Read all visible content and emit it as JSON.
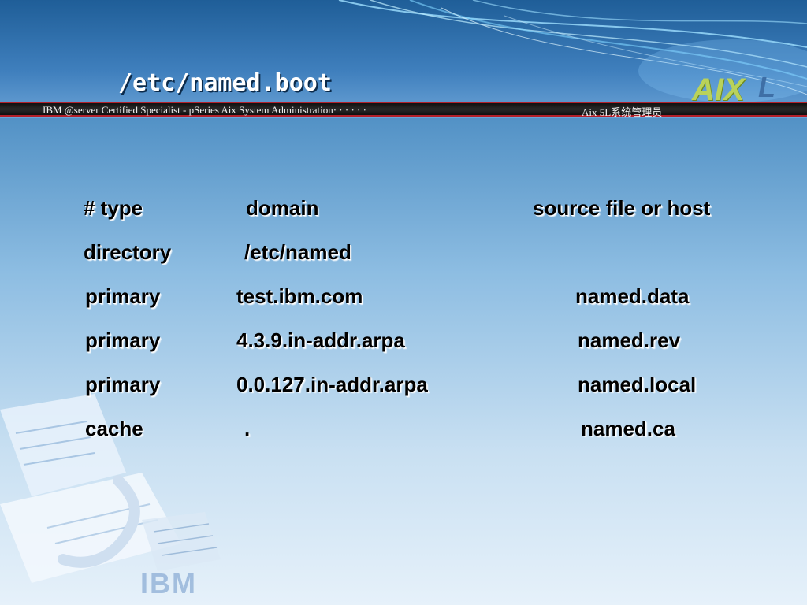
{
  "slide": {
    "title": "/etc/named.boot",
    "banner_left": "IBM @server Certified Specialist - pSeries Aix System Administration· · · · · ·",
    "banner_right": "Aix 5L系统管理员",
    "logo_text": "AIX",
    "logo_suffix": "L",
    "watermark": "IBM"
  },
  "table": {
    "header": {
      "type": "# type",
      "domain": "domain",
      "source": "source file or host"
    },
    "rows": [
      {
        "type": "directory",
        "domain": "/etc/named",
        "source": ""
      },
      {
        "type": "primary",
        "domain": "test.ibm.com",
        "source": "named.data"
      },
      {
        "type": "primary",
        "domain": "4.3.9.in-addr.arpa",
        "source": "named.rev"
      },
      {
        "type": "primary",
        "domain": "0.0.127.in-addr.arpa",
        "source": "named.local"
      },
      {
        "type": "cache",
        "domain": ".",
        "source": "named.ca"
      }
    ]
  },
  "colors": {
    "banner_border": "#b3202a",
    "logo_green": "#b9d25a",
    "text": "#000000"
  }
}
